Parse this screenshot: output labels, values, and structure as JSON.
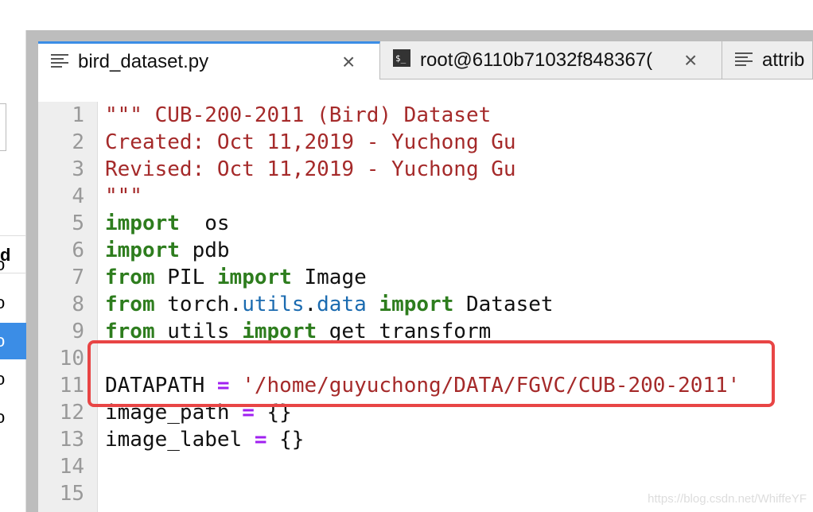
{
  "sidebar": {
    "header": "d",
    "items": [
      {
        "label": "o",
        "selected": false
      },
      {
        "label": "o",
        "selected": false
      },
      {
        "label": "o",
        "selected": true
      },
      {
        "label": "o",
        "selected": false
      },
      {
        "label": "o",
        "selected": false
      }
    ]
  },
  "tabs": [
    {
      "label": "bird_dataset.py",
      "icon": "file-text-icon",
      "active": true
    },
    {
      "label": "root@6110b71032f848367(",
      "icon": "terminal-icon",
      "active": false
    },
    {
      "label": "attrib",
      "icon": "file-text-icon",
      "active": false
    }
  ],
  "close_glyph": "×",
  "code": [
    {
      "n": "1",
      "parts": [
        [
          "s",
          "\"\"\" CUB-200-2011 (Bird) Dataset"
        ]
      ]
    },
    {
      "n": "2",
      "parts": [
        [
          "s",
          "Created: Oct 11,2019 - Yuchong Gu"
        ]
      ]
    },
    {
      "n": "3",
      "parts": [
        [
          "s",
          "Revised: Oct 11,2019 - Yuchong Gu"
        ]
      ]
    },
    {
      "n": "4",
      "parts": [
        [
          "s",
          "\"\"\""
        ]
      ]
    },
    {
      "n": "5",
      "parts": [
        [
          "k",
          "import"
        ],
        [
          "",
          "  os"
        ]
      ]
    },
    {
      "n": "6",
      "parts": [
        [
          "k",
          "import"
        ],
        [
          "",
          " pdb"
        ]
      ]
    },
    {
      "n": "7",
      "parts": [
        [
          "k",
          "from"
        ],
        [
          "",
          " PIL "
        ],
        [
          "k",
          "import"
        ],
        [
          "",
          " Image"
        ]
      ]
    },
    {
      "n": "8",
      "parts": [
        [
          "k",
          "from"
        ],
        [
          "",
          " torch."
        ],
        [
          "m",
          "utils"
        ],
        [
          "",
          "."
        ],
        [
          "m",
          "data"
        ],
        [
          "",
          " "
        ],
        [
          "k",
          "import"
        ],
        [
          "",
          " Dataset"
        ]
      ]
    },
    {
      "n": "9",
      "parts": [
        [
          "k",
          "from"
        ],
        [
          "",
          " utils "
        ],
        [
          "k",
          "import"
        ],
        [
          "",
          " get_transform"
        ]
      ]
    },
    {
      "n": "10",
      "parts": []
    },
    {
      "n": "11",
      "parts": [
        [
          "",
          "DATAPATH "
        ],
        [
          "o",
          "="
        ],
        [
          "",
          " "
        ],
        [
          "s",
          "'/home/guyuchong/DATA/FGVC/CUB-200-2011'"
        ]
      ]
    },
    {
      "n": "12",
      "parts": [
        [
          "",
          "image_path "
        ],
        [
          "o",
          "="
        ],
        [
          "",
          " {}"
        ]
      ]
    },
    {
      "n": "13",
      "parts": [
        [
          "",
          "image_label "
        ],
        [
          "o",
          "="
        ],
        [
          "",
          " {}"
        ]
      ]
    },
    {
      "n": "14",
      "parts": []
    },
    {
      "n": "15",
      "parts": []
    }
  ],
  "watermark": "https://blog.csdn.net/WhiffeYF",
  "colors": {
    "accent": "#3b8de6",
    "highlight_box": "#e84545",
    "string": "#a52a2a",
    "keyword": "#2e7d1e",
    "operator": "#a020f0"
  }
}
